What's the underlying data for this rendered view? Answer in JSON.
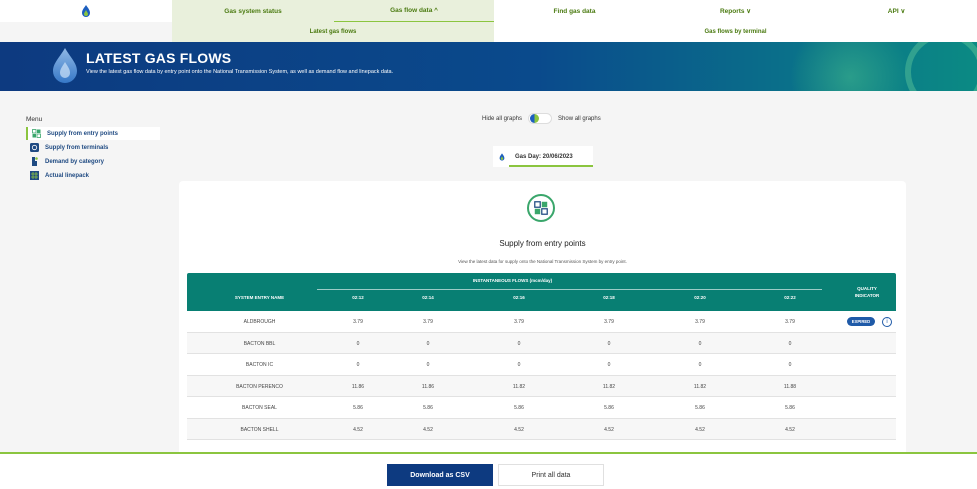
{
  "nav": {
    "items": [
      {
        "label": "Gas system status"
      },
      {
        "label": "Gas flow data ^"
      },
      {
        "label": "Find gas data"
      },
      {
        "label": "Reports ∨"
      },
      {
        "label": "API ∨"
      }
    ],
    "sub_items": [
      {
        "label": "Latest gas flows"
      },
      {
        "label": "Gas flows by terminal"
      }
    ]
  },
  "banner": {
    "title": "LATEST GAS FLOWS",
    "subtitle": "View the latest gas flow data by entry point onto the National Transmission System, as well as demand flow and linepack data."
  },
  "menu": {
    "title": "Menu",
    "items": [
      {
        "label": "Supply from entry points",
        "icon": "grid-icon"
      },
      {
        "label": "Supply from terminals",
        "icon": "terminal-icon"
      },
      {
        "label": "Demand by category",
        "icon": "pin-icon"
      },
      {
        "label": "Actual linepack",
        "icon": "pipes-icon"
      }
    ]
  },
  "graphs": {
    "hide_label": "Hide all graphs",
    "show_label": "Show all graphs"
  },
  "gasday": {
    "label": "Gas Day: 20/06/2023"
  },
  "card": {
    "title": "Supply from entry points",
    "description": "View the latest data for supply onto the National Transmission System by entry point."
  },
  "table": {
    "group_header": "INSTANTANEOUS FLOWS (mcm/day)",
    "name_header": "SYSTEM ENTRY NAME",
    "quality_header_1": "QUALITY",
    "quality_header_2": "INDICATOR",
    "times": [
      "02:12",
      "02:14",
      "02:16",
      "02:18",
      "02:20",
      "02:22"
    ],
    "rows": [
      {
        "name": "ALDBROUGH",
        "values": [
          "3.79",
          "3.79",
          "3.79",
          "3.79",
          "3.79",
          "3.79"
        ],
        "badge": "EXPIRED"
      },
      {
        "name": "BACTON BBL",
        "values": [
          "0",
          "0",
          "0",
          "0",
          "0",
          "0"
        ]
      },
      {
        "name": "BACTON IC",
        "values": [
          "0",
          "0",
          "0",
          "0",
          "0",
          "0"
        ]
      },
      {
        "name": "BACTON PERENCO",
        "values": [
          "11.86",
          "11.86",
          "11.82",
          "11.82",
          "11.82",
          "11.88"
        ]
      },
      {
        "name": "BACTON SEAL",
        "values": [
          "5.86",
          "5.86",
          "5.86",
          "5.86",
          "5.86",
          "5.86"
        ]
      },
      {
        "name": "BACTON SHELL",
        "values": [
          "4.52",
          "4.52",
          "4.52",
          "4.52",
          "4.52",
          "4.52"
        ]
      }
    ]
  },
  "footer": {
    "csv_label": "Download as CSV",
    "print_label": "Print all data"
  },
  "colors": {
    "navy": "#0d3a80",
    "teal": "#087f73",
    "green": "#8bc53f",
    "badge": "#1f5aa8"
  }
}
